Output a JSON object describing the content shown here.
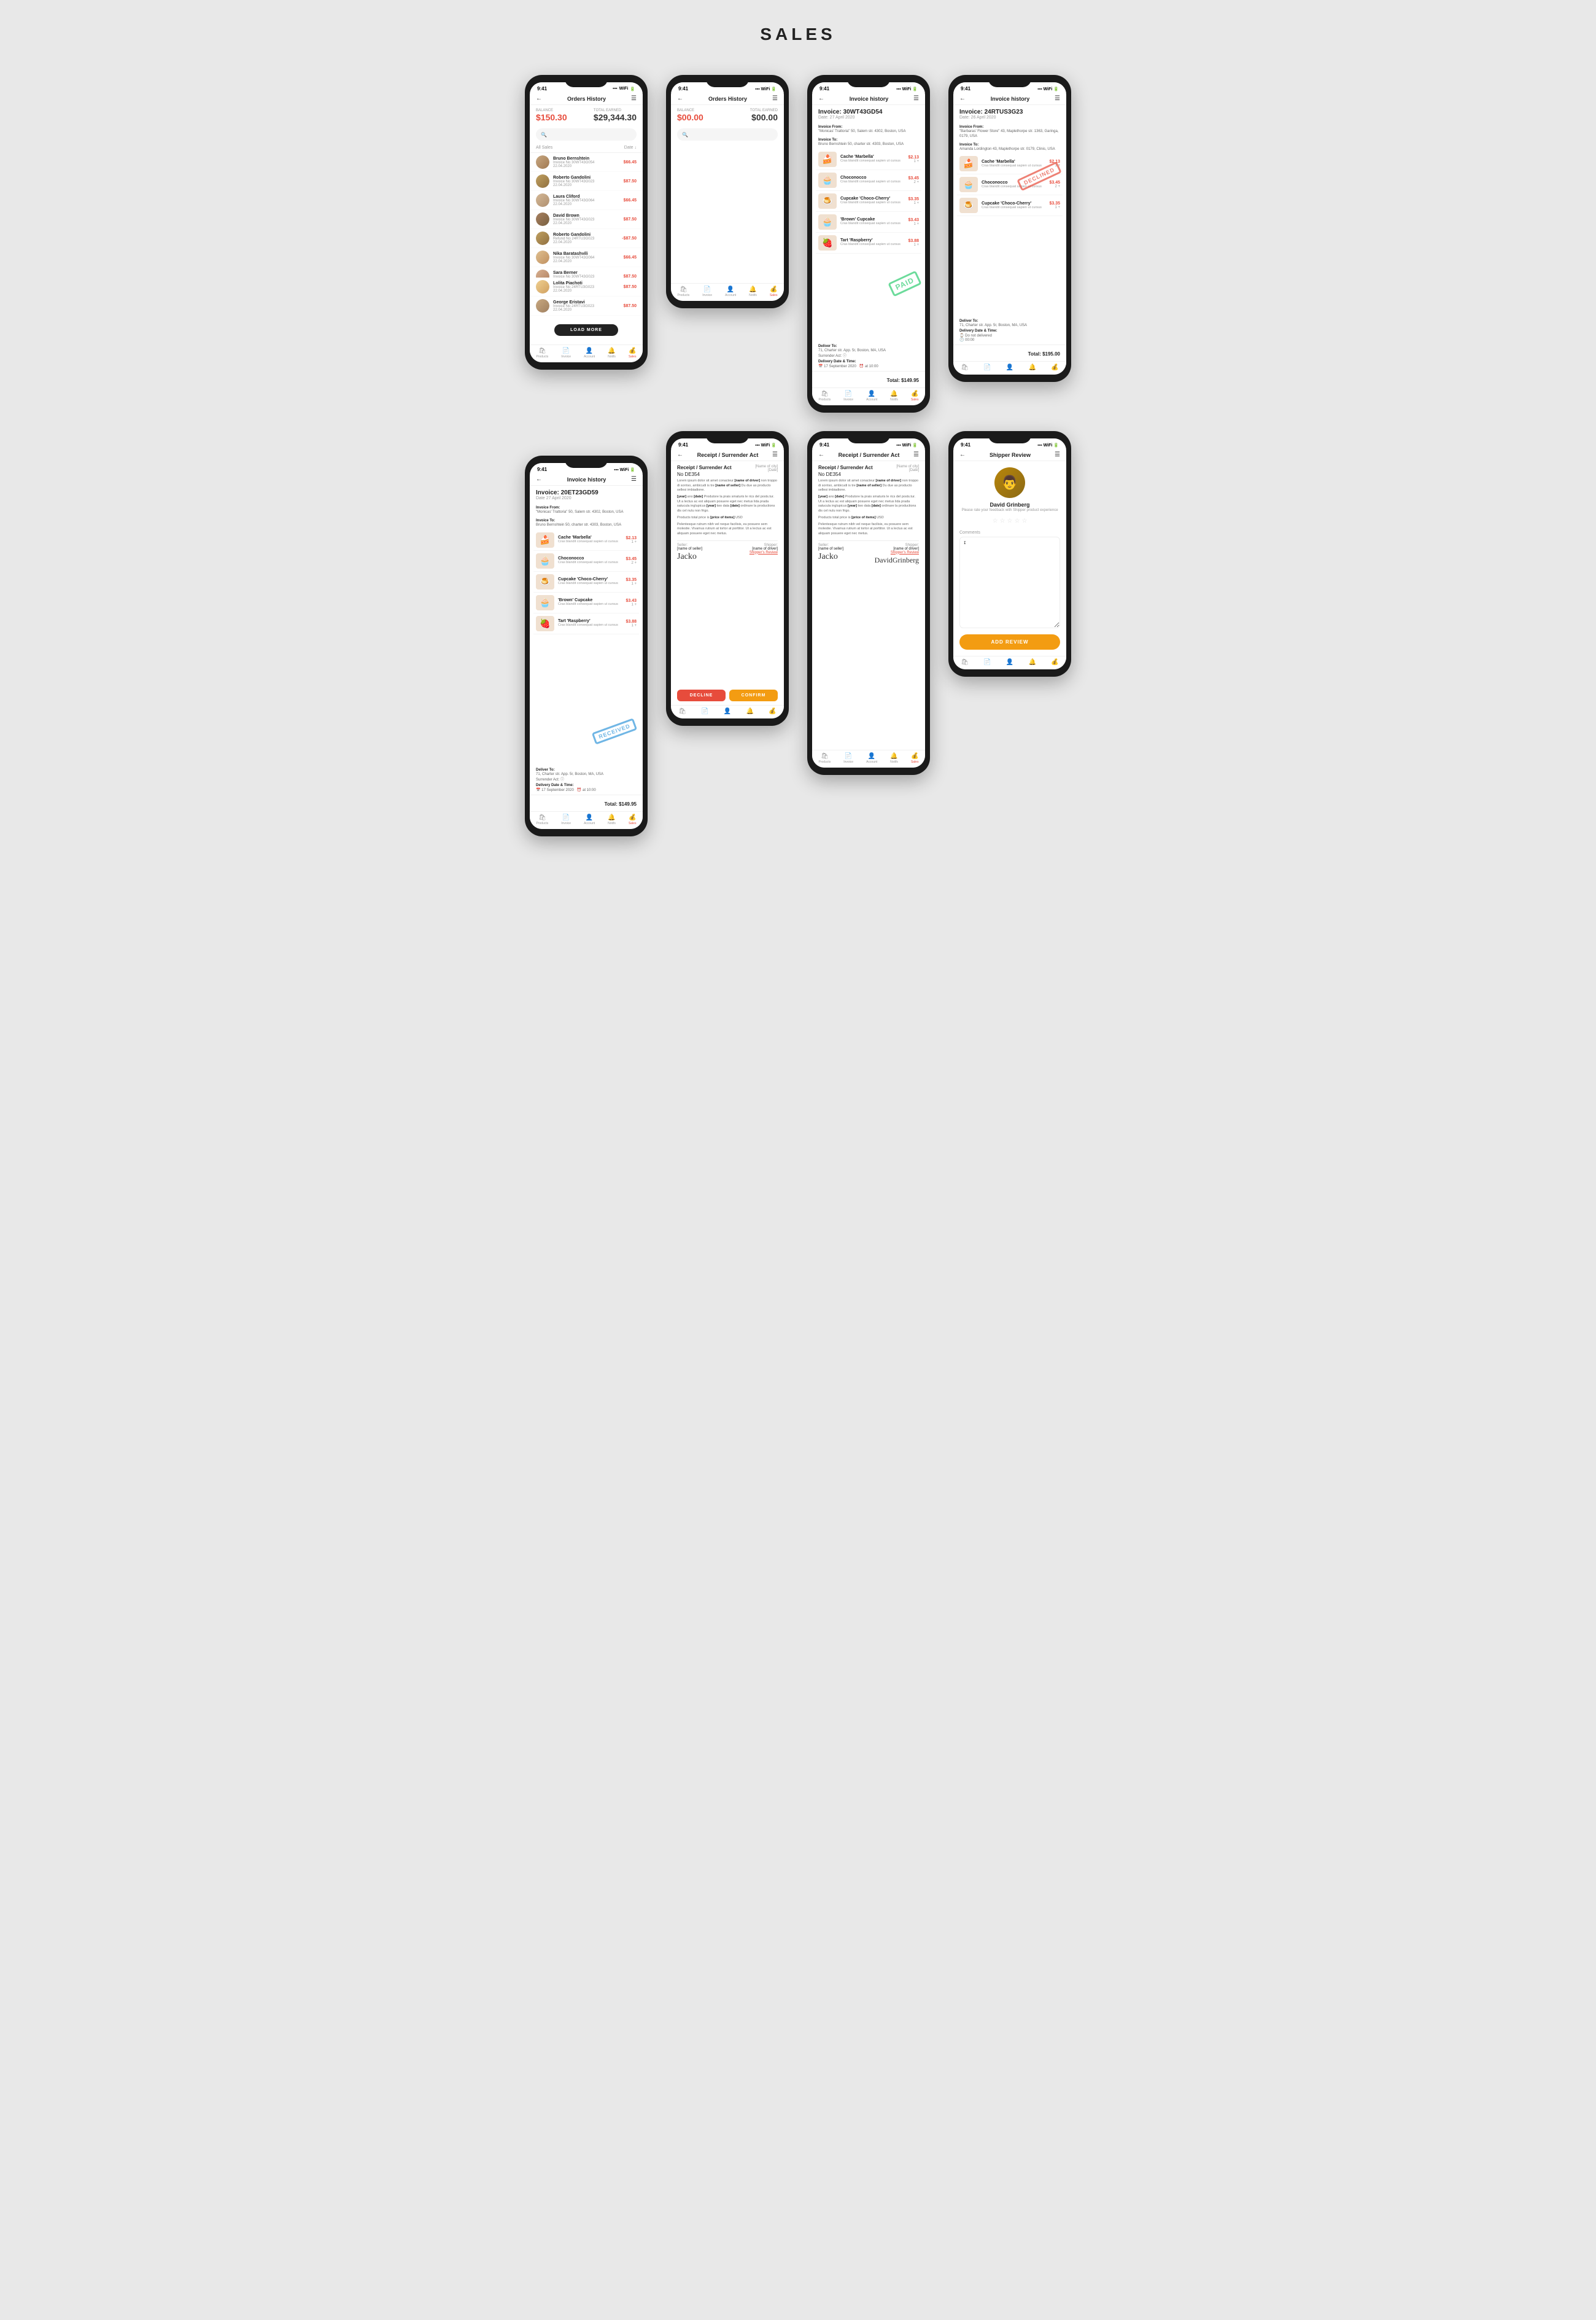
{
  "page": {
    "title": "SALES"
  },
  "phones": [
    {
      "id": "orders-history-1",
      "time": "9:41",
      "screen": "orders_history",
      "header": "Orders History",
      "balance": "$150.30",
      "total_earned": "$29,344.30",
      "balance_label": "BALANCE",
      "earned_label": "TOTAL EARNED",
      "table_col1": "All Sales",
      "table_col2": "Date ↓",
      "orders": [
        {
          "name": "Bruno Bernshtein",
          "invoice": "Invoice No 30WT43G054",
          "date": "22.04.2020",
          "amount": "$66.45",
          "negative": false
        },
        {
          "name": "Roberto Gandolini",
          "invoice": "Invoice No 30WT43G023",
          "date": "22.04.2020",
          "amount": "$87.50",
          "negative": false
        },
        {
          "name": "Laura Cliford",
          "invoice": "Invoice No 30WT43G064",
          "date": "22.04.2020",
          "amount": "$66.45",
          "negative": false
        },
        {
          "name": "David Brown",
          "invoice": "Invoice No 30WT43G023",
          "date": "22.04.2020",
          "amount": "$87.50",
          "negative": false
        },
        {
          "name": "Roberto Gandolini",
          "invoice": "Refund No 24RTU3G023",
          "date": "22.04.2020",
          "amount": "-$87.50",
          "negative": true
        },
        {
          "name": "Nika Baratashvili",
          "invoice": "Invoice No 30WT43G064",
          "date": "22.04.2020",
          "amount": "$66.45",
          "negative": false
        },
        {
          "name": "Sara Berner",
          "invoice": "Invoice No 30WT43G023",
          "date": "22.04.2020",
          "amount": "$87.50",
          "negative": false
        }
      ],
      "extra_orders": [
        {
          "name": "Lolita Piachoti",
          "invoice": "Invoice No 24RTU3G023",
          "date": "22.04.2020",
          "amount": "$87.50"
        },
        {
          "name": "George Eristavi",
          "invoice": "Invoice No 24RTU3G023",
          "date": "22.04.2020",
          "amount": "$87.50"
        }
      ],
      "load_more": "LOAD MORE",
      "nav": [
        "Products",
        "Invoice",
        "Account",
        "Notifications",
        "Sales"
      ]
    },
    {
      "id": "orders-history-2",
      "time": "9:41",
      "screen": "orders_history_empty",
      "header": "Orders History",
      "balance": "$00.00",
      "total_earned": "$00.00",
      "balance_label": "BALANCE",
      "earned_label": "TOTAL EARNED",
      "nav": [
        "Products",
        "Invoice",
        "Account",
        "Notifications",
        "Sales"
      ]
    },
    {
      "id": "invoice-30wt",
      "time": "9:41",
      "screen": "invoice",
      "header": "Invoice history",
      "invoice_no": "Invoice: 30WT43GD54",
      "invoice_date": "Date: 27 April 2020",
      "from_title": "Invoice From:",
      "from_name": "\"Monicas' Trattoria\" 50, Salem str. 4302, Boston, USA",
      "to_title": "Invoice To:",
      "to_name": "Bruno Bernshtein  50, charter str. 4303, Boston, USA",
      "items": [
        {
          "name": "Cache 'Marbella'",
          "desc": "Cras blandit consequat sapien ut cursus",
          "price": "$2.13",
          "qty": "1 +",
          "emoji": "🍰"
        },
        {
          "name": "Choconocco",
          "desc": "Cras blandit consequat sapien ut cursus",
          "price": "$3.45",
          "qty": "2 +",
          "emoji": "🧁"
        },
        {
          "name": "Cupcake 'Choco-Cherry'",
          "desc": "Cras blandit consequat sapien ut cursus",
          "price": "$3.35",
          "qty": "1 +",
          "emoji": "🍮"
        },
        {
          "name": "'Brown' Cupcake",
          "desc": "Cras blandit consequat sapien ut cursus",
          "price": "$3.43",
          "qty": "1 +",
          "emoji": "🧁"
        },
        {
          "name": "Tart 'Raspberry'",
          "desc": "Cras blandit consequat sapien ut cursus",
          "price": "$3.88",
          "qty": "1 +",
          "emoji": "🍓"
        }
      ],
      "deliver_to": "71, Charter str. App. 5r, Boston, MA, USA",
      "surrender_act": "Surrender Act: ⓘ",
      "delivery_date": "17 September 2020",
      "delivery_time": "10:00",
      "total": "Total: $149.95",
      "stamp": "PAID",
      "nav": [
        "Products",
        "Invoice",
        "Account",
        "Notifications",
        "Sales"
      ]
    },
    {
      "id": "invoice-24rtu",
      "time": "9:41",
      "screen": "invoice_declined",
      "header": "Invoice history",
      "invoice_no": "Invoice: 24RTUS3G23",
      "invoice_date": "Date: 26 April 2020",
      "from_title": "Invoice From:",
      "from_name": "\"Barbaras' Flower Store\" 43, Maplethorpe str. 1363, Garinga, 0179, USA",
      "to_title": "Invoice To:",
      "to_name": "Amanda Lordington 43, Maplethorpe str. 0179, Clinis, USA",
      "items": [
        {
          "name": "Cache 'Marbella'",
          "desc": "Cras blandit consequat sapien ut cursus",
          "price": "$2.13",
          "qty": "1 +",
          "emoji": "🍰"
        },
        {
          "name": "Choconocco",
          "desc": "Cras blandit consequat sapien ut cursus",
          "price": "$3.45",
          "qty": "2 +",
          "emoji": "🧁"
        },
        {
          "name": "Cupcake 'Choco-Cherry'",
          "desc": "Cras blandit consequat sapien ut cursus",
          "price": "$3.35",
          "qty": "1 +",
          "emoji": "🍮"
        }
      ],
      "deliver_to": "71, Charter str. App. 5r, Boston, MA, USA",
      "delivery_date_title": "Delivery Date & Time:",
      "delivery_date": "⌚ Do not delivered",
      "delivery_time": "🕐 00:00",
      "total": "Total: $195.00",
      "stamp": "DECLINED",
      "nav": [
        "Products",
        "Invoice",
        "Account",
        "Notifications",
        "Sales"
      ]
    },
    {
      "id": "receipt-confirm",
      "time": "9:41",
      "screen": "receipt_confirm",
      "header": "Receipt / Surrender Act",
      "receipt_title": "Receipt / Surrender Act",
      "receipt_no": "No DE354",
      "city_field": "[Name of city]",
      "date_field": "[Date]",
      "body1": "Lorem ipsum dolor sit amet conacteur [name of driver] non troppo di sorriso, ambicudi is tre [name of seller] Du due as producto sellesi imbiadione.",
      "body2": "[year] [an] [date] Produtore la prais smaturis le rics del posts.tur. Ut a lectus ac est aliquam posuere eget nec metus lida prada satucula inglupicus [year] two data [date] ordinare la productions dis cel nulu non frigo.",
      "body3": "Pelentesque rutrum nibh vel neque facilisis, eu posuere sem molestie. Vivamus rutrum at tortor at porttitor. Ut a lectus ac est aliquam posuere eget nec metus.",
      "price_note": "Products total price is [price of items] USD",
      "seller_label": "Seller:",
      "seller_name": "[name of seller]",
      "shipper_label": "Shipper:",
      "shipper_name": "[name of driver]",
      "shipper_review": "Shipper's Review",
      "seller_sig": "Jacko",
      "shipper_sig": "",
      "btn_decline": "DECLINE",
      "btn_confirm": "CONFIRM",
      "nav": [
        "Products",
        "Invoice",
        "Account",
        "Notifications",
        "Sales"
      ]
    },
    {
      "id": "invoice-20et",
      "time": "9:41",
      "screen": "invoice_large",
      "header": "Invoice history",
      "invoice_no": "Invoice: 20ET23GD59",
      "invoice_date": "Date 27 April 2020",
      "from_title": "Invoice From:",
      "from_name": "\"Monicas' Trattoria\" 50, Salem str. 4302, Boston, USA",
      "to_title": "Invoice To:",
      "to_name": "Bruno Bernshtein  50, charter str. 4303, Boston, USA",
      "items": [
        {
          "name": "Cache 'Marbella'",
          "desc": "Cras blandit consequat sapien ut cursus",
          "price": "$2.13",
          "qty": "1 +",
          "emoji": "🍰"
        },
        {
          "name": "Choconocco",
          "desc": "Cras blandit consequat sapien ut cursus",
          "price": "$3.45",
          "qty": "2 +",
          "emoji": "🧁"
        },
        {
          "name": "Cupcake 'Choco-Cherry'",
          "desc": "Cras blandit consequat sapien ut cursus",
          "price": "$3.35",
          "qty": "1 +",
          "emoji": "🍮"
        },
        {
          "name": "'Brown' Cupcake",
          "desc": "Cras blandit consequat sapien ut cursus",
          "price": "$3.43",
          "qty": "1 +",
          "emoji": "🧁"
        },
        {
          "name": "Tart 'Raspberry'",
          "desc": "Cras blandit consequat sapien ut cursus",
          "price": "$3.88",
          "qty": "1 +",
          "emoji": "🍓"
        }
      ],
      "deliver_to": "71, Charter str. App. 5r, Boston, MA, USA",
      "surrender_act": "Surrender Act: ⓘ",
      "delivery_date": "17 September 2020",
      "delivery_time": "10:00",
      "total": "Total: $149.95",
      "stamp": "RECEIVED",
      "nav": [
        "Products",
        "Invoice",
        "Account",
        "Notifications",
        "Sales"
      ]
    },
    {
      "id": "receipt-signed",
      "time": "9:41",
      "screen": "receipt_signed",
      "header": "Receipt / Surrender Act",
      "receipt_title": "Receipt / Surrender Act",
      "receipt_no": "No DE354",
      "city_field": "[Name of city]",
      "date_field": "[Date]",
      "body1": "Lorem ipsum dolor sit amet conacteur [name of driver] non troppo di sorriso, ambicudi is tre [name of seller] Du due as producto sellesi imbiadione.",
      "body2": "[year] [an] [date] Produtore la prais smaturis le rics del posts.tur. Ut a lectus ac est aliquam posuere eget nec metus lida prada satucula inglupicus [year] two data [date] ordinare la productions dis cel nulu non frigo.",
      "body3": "Pelentesque rutrum nibh vel neque facilisis, eu posuere sem molestie. Vivamus rutrum at tortor at porttitor. Ut a lectus ac est aliquam posuere eget nec metus.",
      "price_note": "Products total price is [price of items] USD",
      "seller_label": "Seller:",
      "seller_name": "[name of seller]",
      "shipper_label": "Shipper:",
      "shipper_name": "[name of driver]",
      "shipper_review": "Shipper's Review",
      "seller_sig": "Jacko",
      "shipper_sig": "DavidGrinberg",
      "nav": [
        "Products",
        "Invoice",
        "Account",
        "Notifications",
        "Sales"
      ]
    },
    {
      "id": "shipper-review",
      "time": "9:41",
      "screen": "shipper_review",
      "header": "Shipper Review",
      "reviewer_name": "David Grinberg",
      "reviewer_subtitle": "Please rate your feedback with Shipper product experience",
      "stars": [
        false,
        false,
        false,
        false,
        false
      ],
      "comments_label": "Comments",
      "comments_placeholder": "I",
      "btn_review": "ADD REVIEW",
      "nav": [
        "Products",
        "Invoice",
        "Account",
        "Notifications",
        "Sales"
      ]
    }
  ]
}
